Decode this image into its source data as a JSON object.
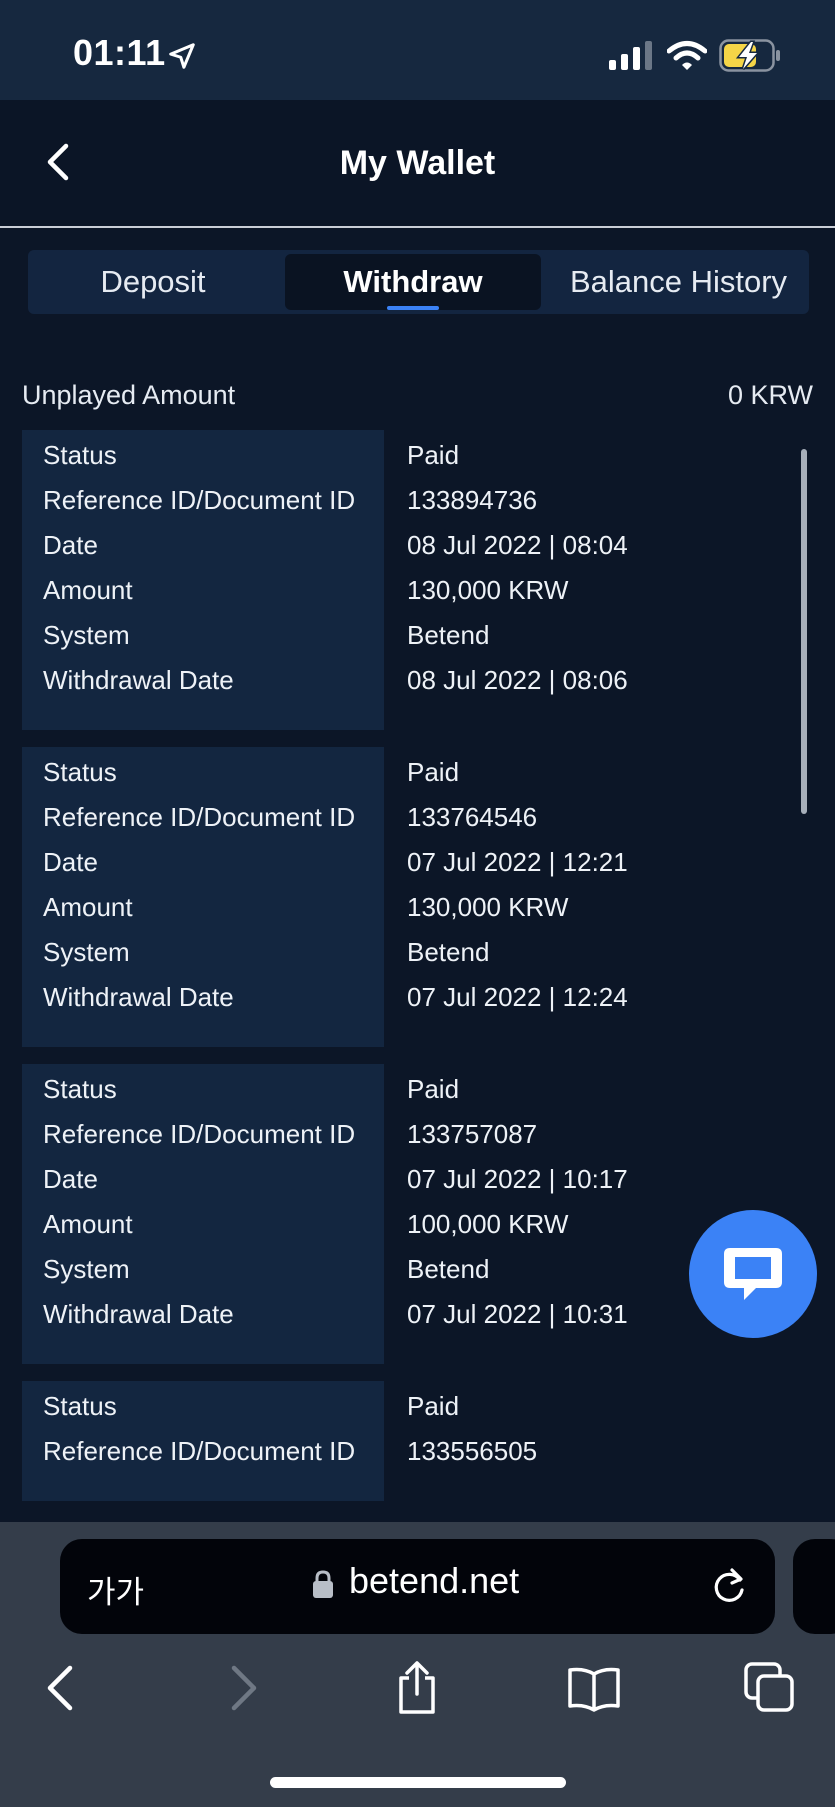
{
  "status_bar": {
    "time": "01:11"
  },
  "header": {
    "title": "My Wallet"
  },
  "tabs": [
    {
      "label": "Deposit",
      "active": false
    },
    {
      "label": "Withdraw",
      "active": true
    },
    {
      "label": "Balance History",
      "active": false
    }
  ],
  "summary": {
    "unplayed_label": "Unplayed Amount",
    "unplayed_value": "0 KRW"
  },
  "field_labels": {
    "status": "Status",
    "reference": "Reference ID/Document ID",
    "date": "Date",
    "amount": "Amount",
    "system": "System",
    "withdrawal_date": "Withdrawal Date"
  },
  "records": [
    {
      "status": "Paid",
      "reference": "133894736",
      "date": "08 Jul 2022 | 08:04",
      "amount": "130,000 KRW",
      "system": "Betend",
      "withdrawal_date": "08 Jul 2022 | 08:06"
    },
    {
      "status": "Paid",
      "reference": "133764546",
      "date": "07 Jul 2022 | 12:21",
      "amount": "130,000 KRW",
      "system": "Betend",
      "withdrawal_date": "07 Jul 2022 | 12:24"
    },
    {
      "status": "Paid",
      "reference": "133757087",
      "date": "07 Jul 2022 | 10:17",
      "amount": "100,000 KRW",
      "system": "Betend",
      "withdrawal_date": "07 Jul 2022 | 10:31"
    },
    {
      "status": "Paid",
      "reference": "133556505"
    }
  ],
  "browser": {
    "aa_label": "가가",
    "url": "betend.net"
  },
  "colors": {
    "accent": "#3b82f6",
    "background": "#0c1627",
    "card": "#132640",
    "status_bar": "#16283f",
    "safari_bar": "#343d4a",
    "battery_charge": "#f5d547"
  },
  "icons": [
    "location-arrow-icon",
    "signal-icon",
    "wifi-icon",
    "battery-charging-icon",
    "back-chevron-icon",
    "chat-bubble-icon",
    "lock-icon",
    "reload-icon",
    "nav-back-icon",
    "nav-forward-icon",
    "share-icon",
    "bookmarks-icon",
    "tabs-icon"
  ]
}
